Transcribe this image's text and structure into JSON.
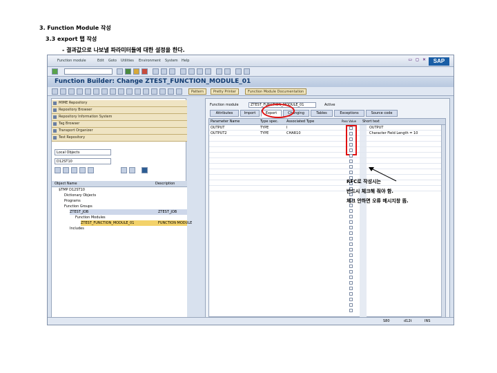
{
  "doc": {
    "heading1": "3. Function Module 작성",
    "heading2": "3.3 export 탭 작성",
    "heading3": "- 결과값으로 나보낼 파라미터들에 대한 설정을 한다."
  },
  "sap": {
    "menu": [
      "Function module",
      "Edit",
      "Goto",
      "Utilities",
      "Environment",
      "System",
      "Help"
    ],
    "logo": "SAP",
    "title": "Function Builder: Change ZTEST_FUNCTION_MODULE_01",
    "app_toolbar": [
      "Pattern",
      "Pretty Printer",
      "Function Module Documentation"
    ],
    "navigator": [
      "MIME Repository",
      "Repository Browser",
      "Repository Information System",
      "Tag Browser",
      "Transport Organizer",
      "Test Repository"
    ],
    "object_type": "Local Objects",
    "object_name": "D12ST10",
    "tree_columns": [
      "Object Name",
      "Description"
    ],
    "tree": [
      {
        "label": "$TMP D12ST10",
        "desc": ""
      },
      {
        "label": "Dictionary Objects",
        "desc": ""
      },
      {
        "label": "Programs",
        "desc": ""
      },
      {
        "label": "Function Groups",
        "desc": ""
      },
      {
        "label": "ZTEST_JOB",
        "desc": "ZTEST_JOB"
      },
      {
        "label": "Function Modules",
        "desc": ""
      },
      {
        "label": "ZTEST_FUNCTION_MODULE_01",
        "desc": "FUNCTION MODULE"
      },
      {
        "label": "Includes",
        "desc": ""
      }
    ],
    "fm_label": "Function module",
    "fm_value": "ZTEST_FUNCTION_MODULE_01",
    "fm_status": "Active",
    "tabs": [
      "Attributes",
      "Import",
      "Export",
      "Changing",
      "Tables",
      "Exceptions",
      "Source code"
    ],
    "columns": [
      "Parameter Name",
      "Type spec.",
      "Associated Type",
      "Pass Value",
      "Short text"
    ],
    "rows": [
      {
        "name": "OUTPUT",
        "type": "TYPE",
        "assoc": "I",
        "text": "OUTPUT"
      },
      {
        "name": "OUTPUT2",
        "type": "TYPE",
        "assoc": "CHAR10",
        "text": "Character Field Length = 10"
      }
    ],
    "status_items": [
      "S80",
      "d12t",
      "INS"
    ]
  },
  "annotation": [
    "RFC로 작성시는",
    "반드시 체크해 줘야 함.",
    "체크 안하면 오류 메시지창 뜸."
  ]
}
